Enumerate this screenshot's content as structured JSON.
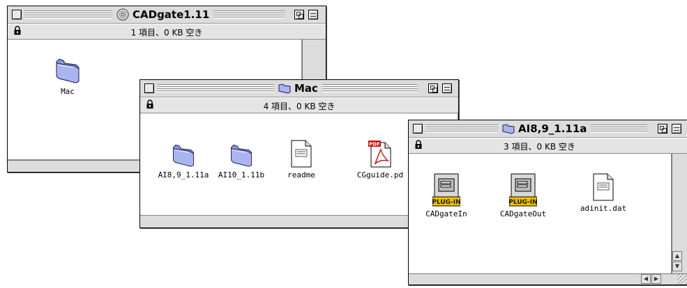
{
  "windows": {
    "cd": {
      "title": "CADgate1.11",
      "info": "1 項目、0 KB 空き",
      "items": [
        {
          "label": "Mac",
          "icon": "folder-icon"
        }
      ]
    },
    "mac": {
      "title": "Mac",
      "info": "4 項目、0 KB 空き",
      "items": [
        {
          "label": "AI8,9_1.11a",
          "icon": "folder-icon"
        },
        {
          "label": "AI10_1.11b",
          "icon": "folder-icon"
        },
        {
          "label": "readme",
          "icon": "text-document-icon"
        },
        {
          "label": "CGguide.pd",
          "icon": "pdf-document-icon"
        }
      ]
    },
    "ai": {
      "title": "AI8,9_1.11a",
      "info": "3 項目、0 KB 空き",
      "items": [
        {
          "label": "CADgateIn",
          "icon": "plugin-icon",
          "badge": "PLUG-IN"
        },
        {
          "label": "CADgateOut",
          "icon": "plugin-icon",
          "badge": "PLUG-IN"
        },
        {
          "label": "adinit.dat",
          "icon": "text-document-icon"
        }
      ]
    }
  },
  "colors": {
    "folder": "#aab4ef",
    "window_chrome": "#dcdcdc",
    "pdf_red": "#cc1111",
    "plugin_yellow": "#f2c200"
  }
}
